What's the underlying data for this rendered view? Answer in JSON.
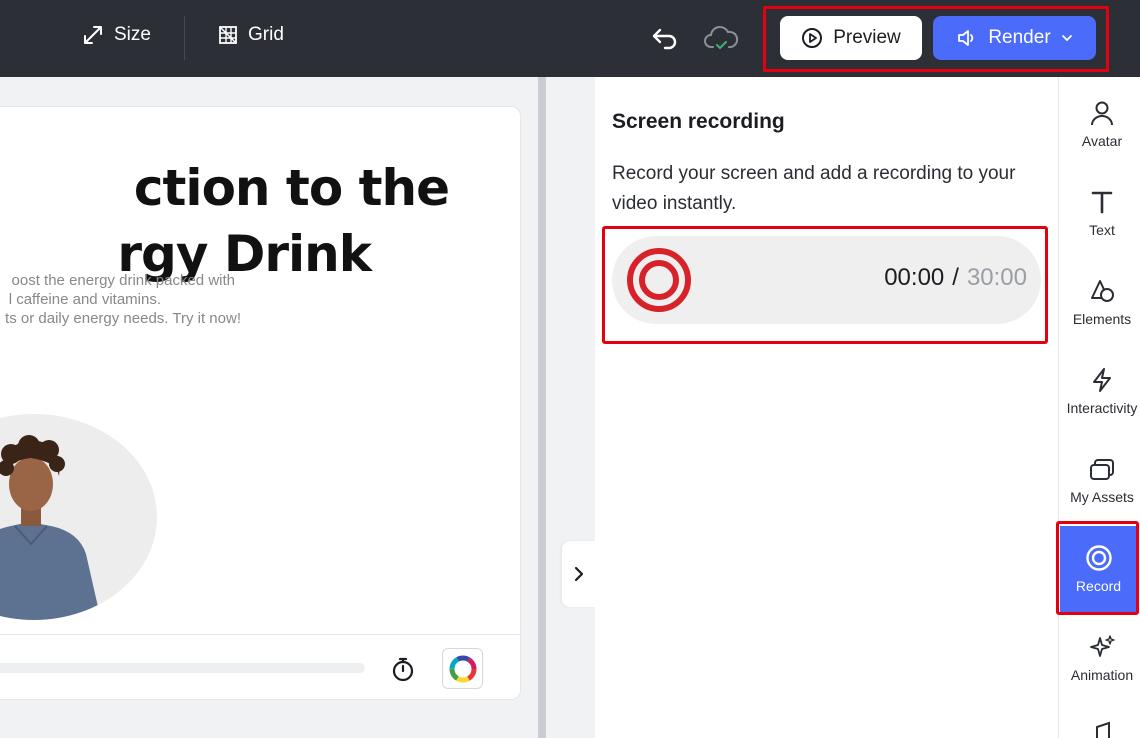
{
  "topbar": {
    "size_label": "Size",
    "grid_label": "Grid",
    "preview_label": "Preview",
    "render_label": "Render"
  },
  "canvas": {
    "title_line1": "ction to the",
    "title_line2": "rgy Drink",
    "body_line1": "oost the energy drink packed with",
    "body_line2": "l caffeine and vitamins.",
    "body_line3": "ts or daily energy needs. Try it now!"
  },
  "panel": {
    "title": "Screen recording",
    "description": "Record your screen and add a recording to your video instantly.",
    "elapsed": "00:00",
    "separator": "/",
    "limit": "30:00"
  },
  "rail": {
    "items": [
      {
        "label": "Avatar",
        "icon": "person-icon"
      },
      {
        "label": "Text",
        "icon": "text-icon"
      },
      {
        "label": "Elements",
        "icon": "shapes-icon"
      },
      {
        "label": "Interactivity",
        "icon": "lightning-icon"
      },
      {
        "label": "My Assets",
        "icon": "folder-stack-icon"
      },
      {
        "label": "Record",
        "icon": "record-icon"
      },
      {
        "label": "Animation",
        "icon": "sparkle-icon"
      }
    ],
    "active": "Record"
  },
  "colors": {
    "topbar_bg": "#2c3036",
    "accent": "#4b6bfb",
    "record_red": "#d8222a",
    "highlight": "#e3000f"
  }
}
